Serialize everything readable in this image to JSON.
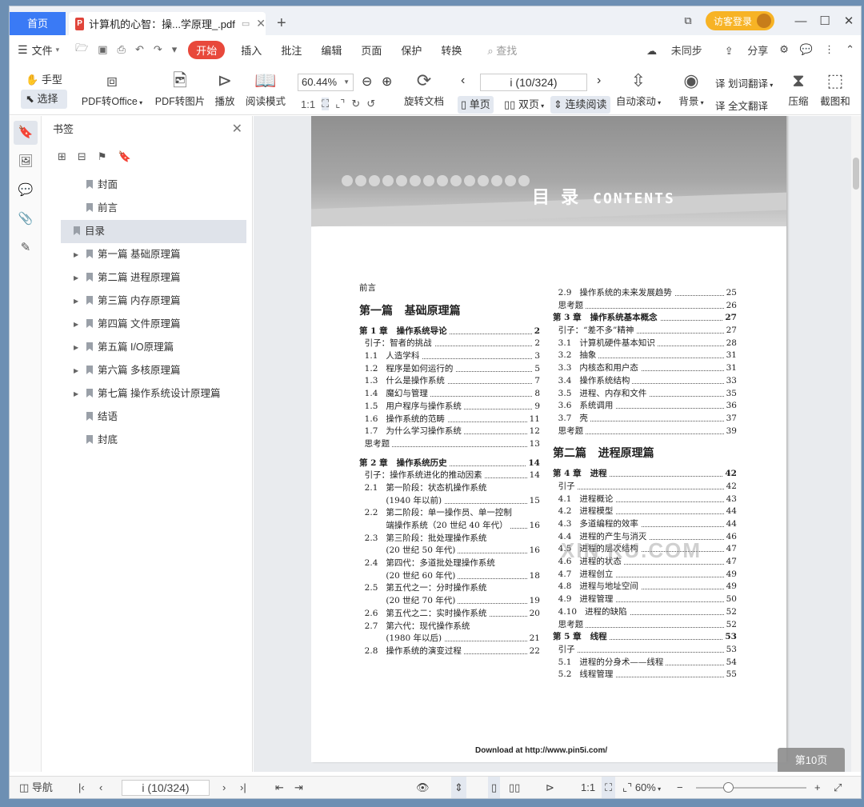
{
  "tabs": {
    "home": "首页",
    "document": "计算机的心智：操...学原理_.pdf",
    "new": "+"
  },
  "titlebar": {
    "login": "访客登录"
  },
  "menu": {
    "file": "文件",
    "items": [
      "开始",
      "插入",
      "批注",
      "编辑",
      "页面",
      "保护",
      "转换"
    ],
    "search_placeholder": "查找",
    "sync": "未同步",
    "share": "分享"
  },
  "ribbon": {
    "hand": "手型",
    "select": "选择",
    "pdf_to_office": "PDF转Office",
    "pdf_to_image": "PDF转图片",
    "play": "播放",
    "read_mode": "阅读模式",
    "zoom": "60.44%",
    "rotate": "旋转文档",
    "page_indicator": "i (10/324)",
    "single": "单页",
    "double": "双页",
    "continuous": "连续阅读",
    "auto_scroll": "自动滚动",
    "background": "背景",
    "word_translate": "划词翻译",
    "full_translate": "全文翻译",
    "compress": "压缩",
    "screenshot": "截图和"
  },
  "bookmarks": {
    "title": "书签",
    "items": [
      {
        "label": "封面",
        "expandable": false
      },
      {
        "label": "前言",
        "expandable": false
      },
      {
        "label": "目录",
        "expandable": false,
        "selected": true
      },
      {
        "label": "第一篇 基础原理篇",
        "expandable": true
      },
      {
        "label": "第二篇 进程原理篇",
        "expandable": true
      },
      {
        "label": "第三篇 内存原理篇",
        "expandable": true
      },
      {
        "label": "第四篇 文件原理篇",
        "expandable": true
      },
      {
        "label": "第五篇 I/O原理篇",
        "expandable": true
      },
      {
        "label": "第六篇 多核原理篇",
        "expandable": true
      },
      {
        "label": "第七篇 操作系统设计原理篇",
        "expandable": true
      },
      {
        "label": "结语",
        "expandable": false
      },
      {
        "label": "封底",
        "expandable": false
      }
    ]
  },
  "page": {
    "banner_title": "目 录",
    "banner_en": "CONTENTS",
    "watermark": "XIN  KU.COM",
    "download": "Download at http://www.pin5i.com/",
    "page_badge": "第10页",
    "left_col": [
      {
        "t": "前言",
        "p": "",
        "kind": "plain"
      },
      {
        "t": "第一篇   基础原理篇",
        "p": "",
        "kind": "h"
      },
      {
        "t": "第 1 章   操作系统导论",
        "p": "2",
        "kind": "ch"
      },
      {
        "t": "  引子：智者的挑战",
        "p": "2"
      },
      {
        "t": "  1.1   人造学科",
        "p": "3"
      },
      {
        "t": "  1.2   程序是如何运行的",
        "p": "5"
      },
      {
        "t": "  1.3   什么是操作系统",
        "p": "7"
      },
      {
        "t": "  1.4   魔幻与管理",
        "p": "8"
      },
      {
        "t": "  1.5   用户程序与操作系统",
        "p": "9"
      },
      {
        "t": "  1.6   操作系统的范畴",
        "p": "11"
      },
      {
        "t": "  1.7   为什么学习操作系统",
        "p": "12"
      },
      {
        "t": "  思考题",
        "p": "13"
      },
      {
        "t": "",
        "p": "",
        "kind": "gap"
      },
      {
        "t": "第 2 章   操作系统历史",
        "p": "14",
        "kind": "ch"
      },
      {
        "t": "  引子：操作系统进化的推动因素",
        "p": "14"
      },
      {
        "t": "  2.1   第一阶段：状态机操作系统",
        "p": "",
        "kind": "plain"
      },
      {
        "t": "          (1940 年以前)",
        "p": "15"
      },
      {
        "t": "  2.2   第二阶段：单一操作员、单一控制",
        "p": "",
        "kind": "plain"
      },
      {
        "t": "          端操作系统（20 世纪 40 年代）",
        "p": "16"
      },
      {
        "t": "  2.3   第三阶段：批处理操作系统",
        "p": "",
        "kind": "plain"
      },
      {
        "t": "          (20 世纪 50 年代)",
        "p": "16"
      },
      {
        "t": "  2.4   第四代：多道批处理操作系统",
        "p": "",
        "kind": "plain"
      },
      {
        "t": "          (20 世纪 60 年代)",
        "p": "18"
      },
      {
        "t": "  2.5   第五代之一：分时操作系统",
        "p": "",
        "kind": "plain"
      },
      {
        "t": "          (20 世纪 70 年代)",
        "p": "19"
      },
      {
        "t": "  2.6   第五代之二：实时操作系统",
        "p": "20"
      },
      {
        "t": "  2.7   第六代：现代操作系统",
        "p": "",
        "kind": "plain"
      },
      {
        "t": "          (1980 年以后)",
        "p": "21"
      },
      {
        "t": "  2.8   操作系统的演变过程",
        "p": "22"
      }
    ],
    "right_col": [
      {
        "t": "  2.9   操作系统的未来发展趋势",
        "p": "25"
      },
      {
        "t": "  思考题",
        "p": "26"
      },
      {
        "t": "第 3 章   操作系统基本概念",
        "p": "27",
        "kind": "ch"
      },
      {
        "t": "  引子：“差不多”精神",
        "p": "27"
      },
      {
        "t": "  3.1   计算机硬件基本知识",
        "p": "28"
      },
      {
        "t": "  3.2   抽象",
        "p": "31"
      },
      {
        "t": "  3.3   内核态和用户态",
        "p": "31"
      },
      {
        "t": "  3.4   操作系统结构",
        "p": "33"
      },
      {
        "t": "  3.5   进程、内存和文件",
        "p": "35"
      },
      {
        "t": "  3.6   系统调用",
        "p": "36"
      },
      {
        "t": "  3.7   壳",
        "p": "37"
      },
      {
        "t": "  思考题",
        "p": "39"
      },
      {
        "t": "第二篇   进程原理篇",
        "p": "",
        "kind": "h"
      },
      {
        "t": "第 4 章   进程",
        "p": "42",
        "kind": "ch"
      },
      {
        "t": "  引子",
        "p": "42"
      },
      {
        "t": "  4.1   进程概论",
        "p": "43"
      },
      {
        "t": "  4.2   进程模型",
        "p": "44"
      },
      {
        "t": "  4.3   多道编程的效率",
        "p": "44"
      },
      {
        "t": "  4.4   进程的产生与消灭",
        "p": "46"
      },
      {
        "t": "  4.5   进程的层次结构",
        "p": "47"
      },
      {
        "t": "  4.6   进程的状态",
        "p": "47"
      },
      {
        "t": "  4.7   进程创立",
        "p": "49"
      },
      {
        "t": "  4.8   进程与地址空间",
        "p": "49"
      },
      {
        "t": "  4.9   进程管理",
        "p": "50"
      },
      {
        "t": "  4.10   进程的缺陷",
        "p": "52"
      },
      {
        "t": "  思考题",
        "p": "52"
      },
      {
        "t": "第 5 章   线程",
        "p": "53",
        "kind": "ch"
      },
      {
        "t": "  引子",
        "p": "53"
      },
      {
        "t": "  5.1   进程的分身术——线程",
        "p": "54"
      },
      {
        "t": "  5.2   线程管理",
        "p": "55"
      }
    ]
  },
  "status": {
    "nav": "导航",
    "page_indicator": "i (10/324)",
    "zoom": "60%"
  }
}
